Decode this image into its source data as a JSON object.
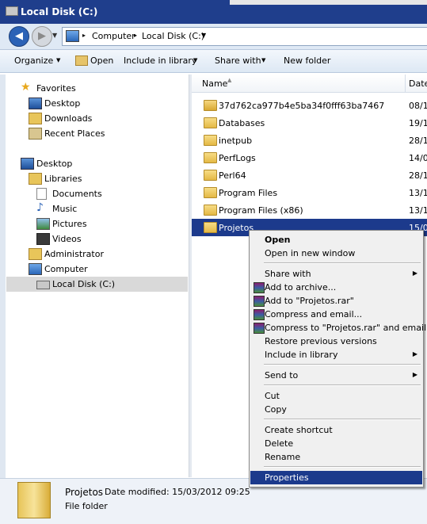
{
  "window": {
    "title": "Local Disk (C:)"
  },
  "address": {
    "crumbs": [
      "Computer",
      "Local Disk (C:)"
    ]
  },
  "toolbar": {
    "organize": "Organize",
    "open": "Open",
    "include_in_library": "Include in library",
    "share_with": "Share with",
    "new_folder": "New folder"
  },
  "nav": {
    "favorites": "Favorites",
    "desktop_fav": "Desktop",
    "downloads": "Downloads",
    "recent_places": "Recent Places",
    "desktop": "Desktop",
    "libraries": "Libraries",
    "documents": "Documents",
    "music": "Music",
    "pictures": "Pictures",
    "videos": "Videos",
    "administrator": "Administrator",
    "computer": "Computer",
    "local_disk": "Local Disk (C:)"
  },
  "columns": {
    "name": "Name",
    "date": "Date"
  },
  "files": [
    {
      "name": "37d762ca977b4e5ba34f0fff63ba7467",
      "date": "08/1",
      "icon": "locked-folder-icon"
    },
    {
      "name": "Databases",
      "date": "19/1",
      "icon": "folder-icon"
    },
    {
      "name": "inetpub",
      "date": "28/1",
      "icon": "folder-icon"
    },
    {
      "name": "PerfLogs",
      "date": "14/0",
      "icon": "folder-icon"
    },
    {
      "name": "Perl64",
      "date": "28/1",
      "icon": "folder-icon"
    },
    {
      "name": "Program Files",
      "date": "13/1",
      "icon": "folder-icon"
    },
    {
      "name": "Program Files (x86)",
      "date": "13/1",
      "icon": "folder-icon"
    },
    {
      "name": "Projetos",
      "date": "15/0",
      "icon": "folder-icon",
      "selected": true
    }
  ],
  "context_menu": {
    "open": "Open",
    "open_new_window": "Open in new window",
    "share_with": "Share with",
    "add_to_archive": "Add to archive...",
    "add_to_rar": "Add to \"Projetos.rar\"",
    "compress_email": "Compress and email...",
    "compress_rar_email": "Compress to \"Projetos.rar\" and email",
    "restore_versions": "Restore previous versions",
    "include_in_library": "Include in library",
    "send_to": "Send to",
    "cut": "Cut",
    "copy": "Copy",
    "create_shortcut": "Create shortcut",
    "delete": "Delete",
    "rename": "Rename",
    "properties": "Properties"
  },
  "details": {
    "name": "Projetos",
    "modified": "Date modified: 15/03/2012 09:25",
    "type": "File folder"
  }
}
